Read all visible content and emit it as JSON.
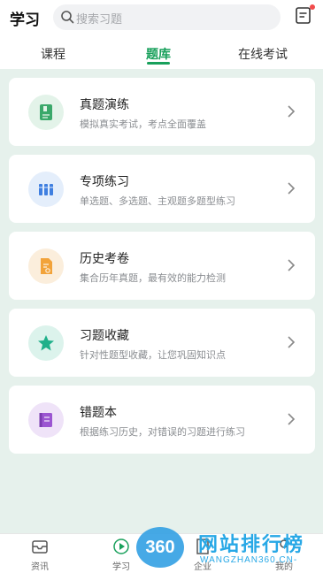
{
  "header": {
    "title": "学习",
    "search_placeholder": "搜索习题"
  },
  "tabs": [
    "课程",
    "题库",
    "在线考试"
  ],
  "cards": [
    {
      "title": "真题演练",
      "desc": "模拟真实考试，考点全面覆盖",
      "icon": "green-book-icon",
      "color": "#3aa86a"
    },
    {
      "title": "专项练习",
      "desc": "单选题、多选题、主观题多题型练习",
      "icon": "books-icon",
      "color": "#3f7fe0"
    },
    {
      "title": "历史考卷",
      "desc": "集合历年真题，最有效的能力检测",
      "icon": "exam-paper-icon",
      "color": "#f2a33a"
    },
    {
      "title": "习题收藏",
      "desc": "针对性题型收藏，让您巩固知识点",
      "icon": "star-icon",
      "color": "#1fb08a"
    },
    {
      "title": "错题本",
      "desc": "根据练习历史，对错误的习题进行练习",
      "icon": "notebook-icon",
      "color": "#9b55d1"
    }
  ],
  "bottom_nav": [
    "资讯",
    "学习",
    "企业",
    "我的"
  ],
  "watermark": {
    "badge": "360",
    "brand": "网站排行榜",
    "domain": "WANGZHAN360.CN-"
  }
}
